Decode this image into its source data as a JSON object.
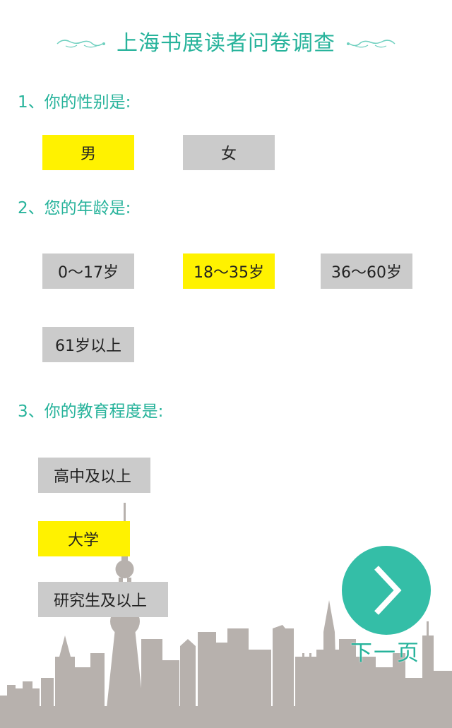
{
  "header": {
    "title": "上海书展读者问卷调查"
  },
  "questions": [
    {
      "label": "1、你的性别是:",
      "options": [
        {
          "label": "男",
          "selected": true
        },
        {
          "label": "女",
          "selected": false
        }
      ]
    },
    {
      "label": "2、您的年龄是:",
      "options": [
        {
          "label": "0～17岁",
          "selected": false
        },
        {
          "label": "18～35岁",
          "selected": true
        },
        {
          "label": "36～60岁",
          "selected": false
        },
        {
          "label": "61岁以上",
          "selected": false
        }
      ]
    },
    {
      "label": "3、你的教育程度是:",
      "options": [
        {
          "label": "高中及以上",
          "selected": false
        },
        {
          "label": "大学",
          "selected": true
        },
        {
          "label": "研究生及以上",
          "selected": false
        }
      ]
    }
  ],
  "next": {
    "label": "下一页",
    "icon": "chevron-right-icon"
  },
  "colors": {
    "accent": "#27b39b",
    "selected": "#fff200",
    "unselected": "#cbcbcb",
    "skyline": "#b7b1ad",
    "next_button": "#34bea7"
  }
}
